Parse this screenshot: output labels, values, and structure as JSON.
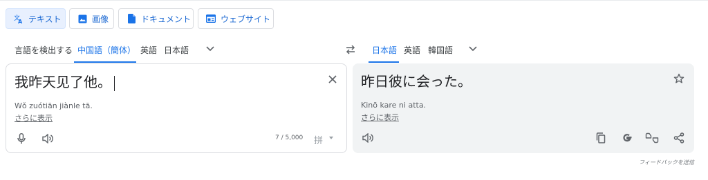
{
  "modes": [
    {
      "label": "テキスト",
      "icon": "translate-icon"
    },
    {
      "label": "画像",
      "icon": "image-icon"
    },
    {
      "label": "ドキュメント",
      "icon": "document-icon"
    },
    {
      "label": "ウェブサイト",
      "icon": "website-icon"
    }
  ],
  "source": {
    "detect_label": "言語を検出する",
    "languages": [
      "中国語（簡体）",
      "英語",
      "日本語"
    ],
    "selected": "中国語（簡体）",
    "text": "我昨天见了他。",
    "romanization": "Wǒ zuótiān jiànle tā.",
    "show_more": "さらに表示",
    "char_count": "7 / 5,000",
    "ime_glyph": "拼"
  },
  "target": {
    "languages": [
      "日本語",
      "英語",
      "韓国語"
    ],
    "selected": "日本語",
    "text": "昨日彼に会った。",
    "romanization": "Kinō kare ni atta.",
    "show_more": "さらに表示"
  },
  "feedback_label": "フィードバックを送信",
  "colors": {
    "accent": "#1a73e8",
    "active_bg": "#e8f0fe",
    "panel_bg": "#f1f3f4"
  }
}
